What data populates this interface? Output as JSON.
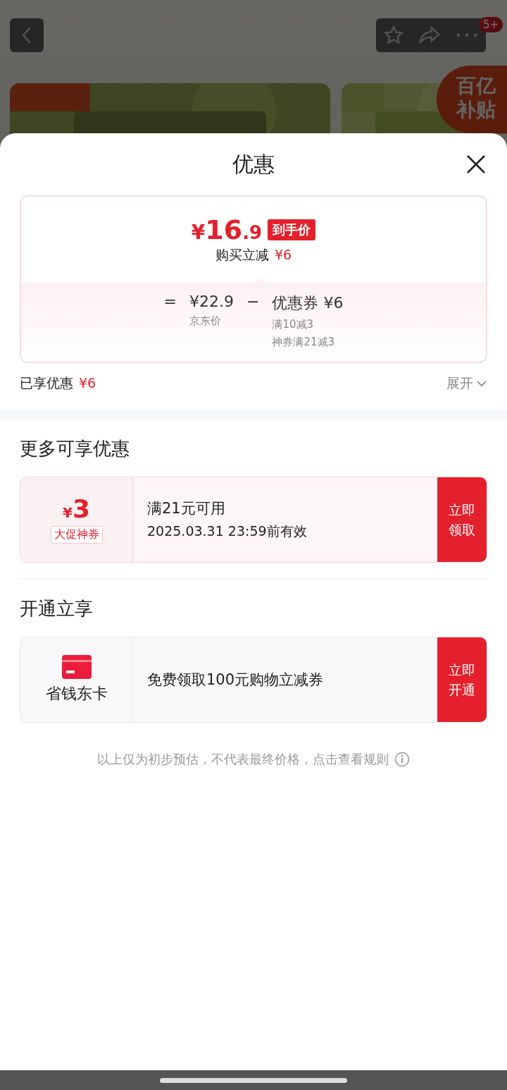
{
  "background_page": {
    "notification_badge": "5+",
    "subsidy_badge": "百亿补贴"
  },
  "sheet": {
    "title": "优惠",
    "summary": {
      "currency": "¥",
      "integer": "16",
      "decimal": ".9",
      "price_tag": "到手价",
      "saving_label": "购买立减",
      "saving_amount": "¥6",
      "breakdown": {
        "equals": "=",
        "base_price": "¥22.9",
        "base_label": "京东价",
        "minus": "−",
        "coupon_title": "优惠券 ¥6",
        "coupon_rules": [
          "满10减3",
          "神券满21减3"
        ]
      }
    },
    "enjoyed": {
      "label": "已享优惠",
      "amount": "¥6",
      "toggle": "展开",
      "expanded": false
    },
    "more_section": {
      "heading": "更多可享优惠",
      "coupons": [
        {
          "currency": "¥",
          "amount": "3",
          "tag": "大促神券",
          "condition": "满21元可用",
          "validity": "2025.03.31 23:59前有效",
          "action": "立即领取"
        }
      ]
    },
    "membership_section": {
      "heading": "开通立享",
      "offers": [
        {
          "name": "省钱东卡",
          "description": "免费领取100元购物立减券",
          "action": "立即开通"
        }
      ]
    },
    "footnote": "以上仅为初步预估，不代表最终价格，点击查看规则"
  }
}
